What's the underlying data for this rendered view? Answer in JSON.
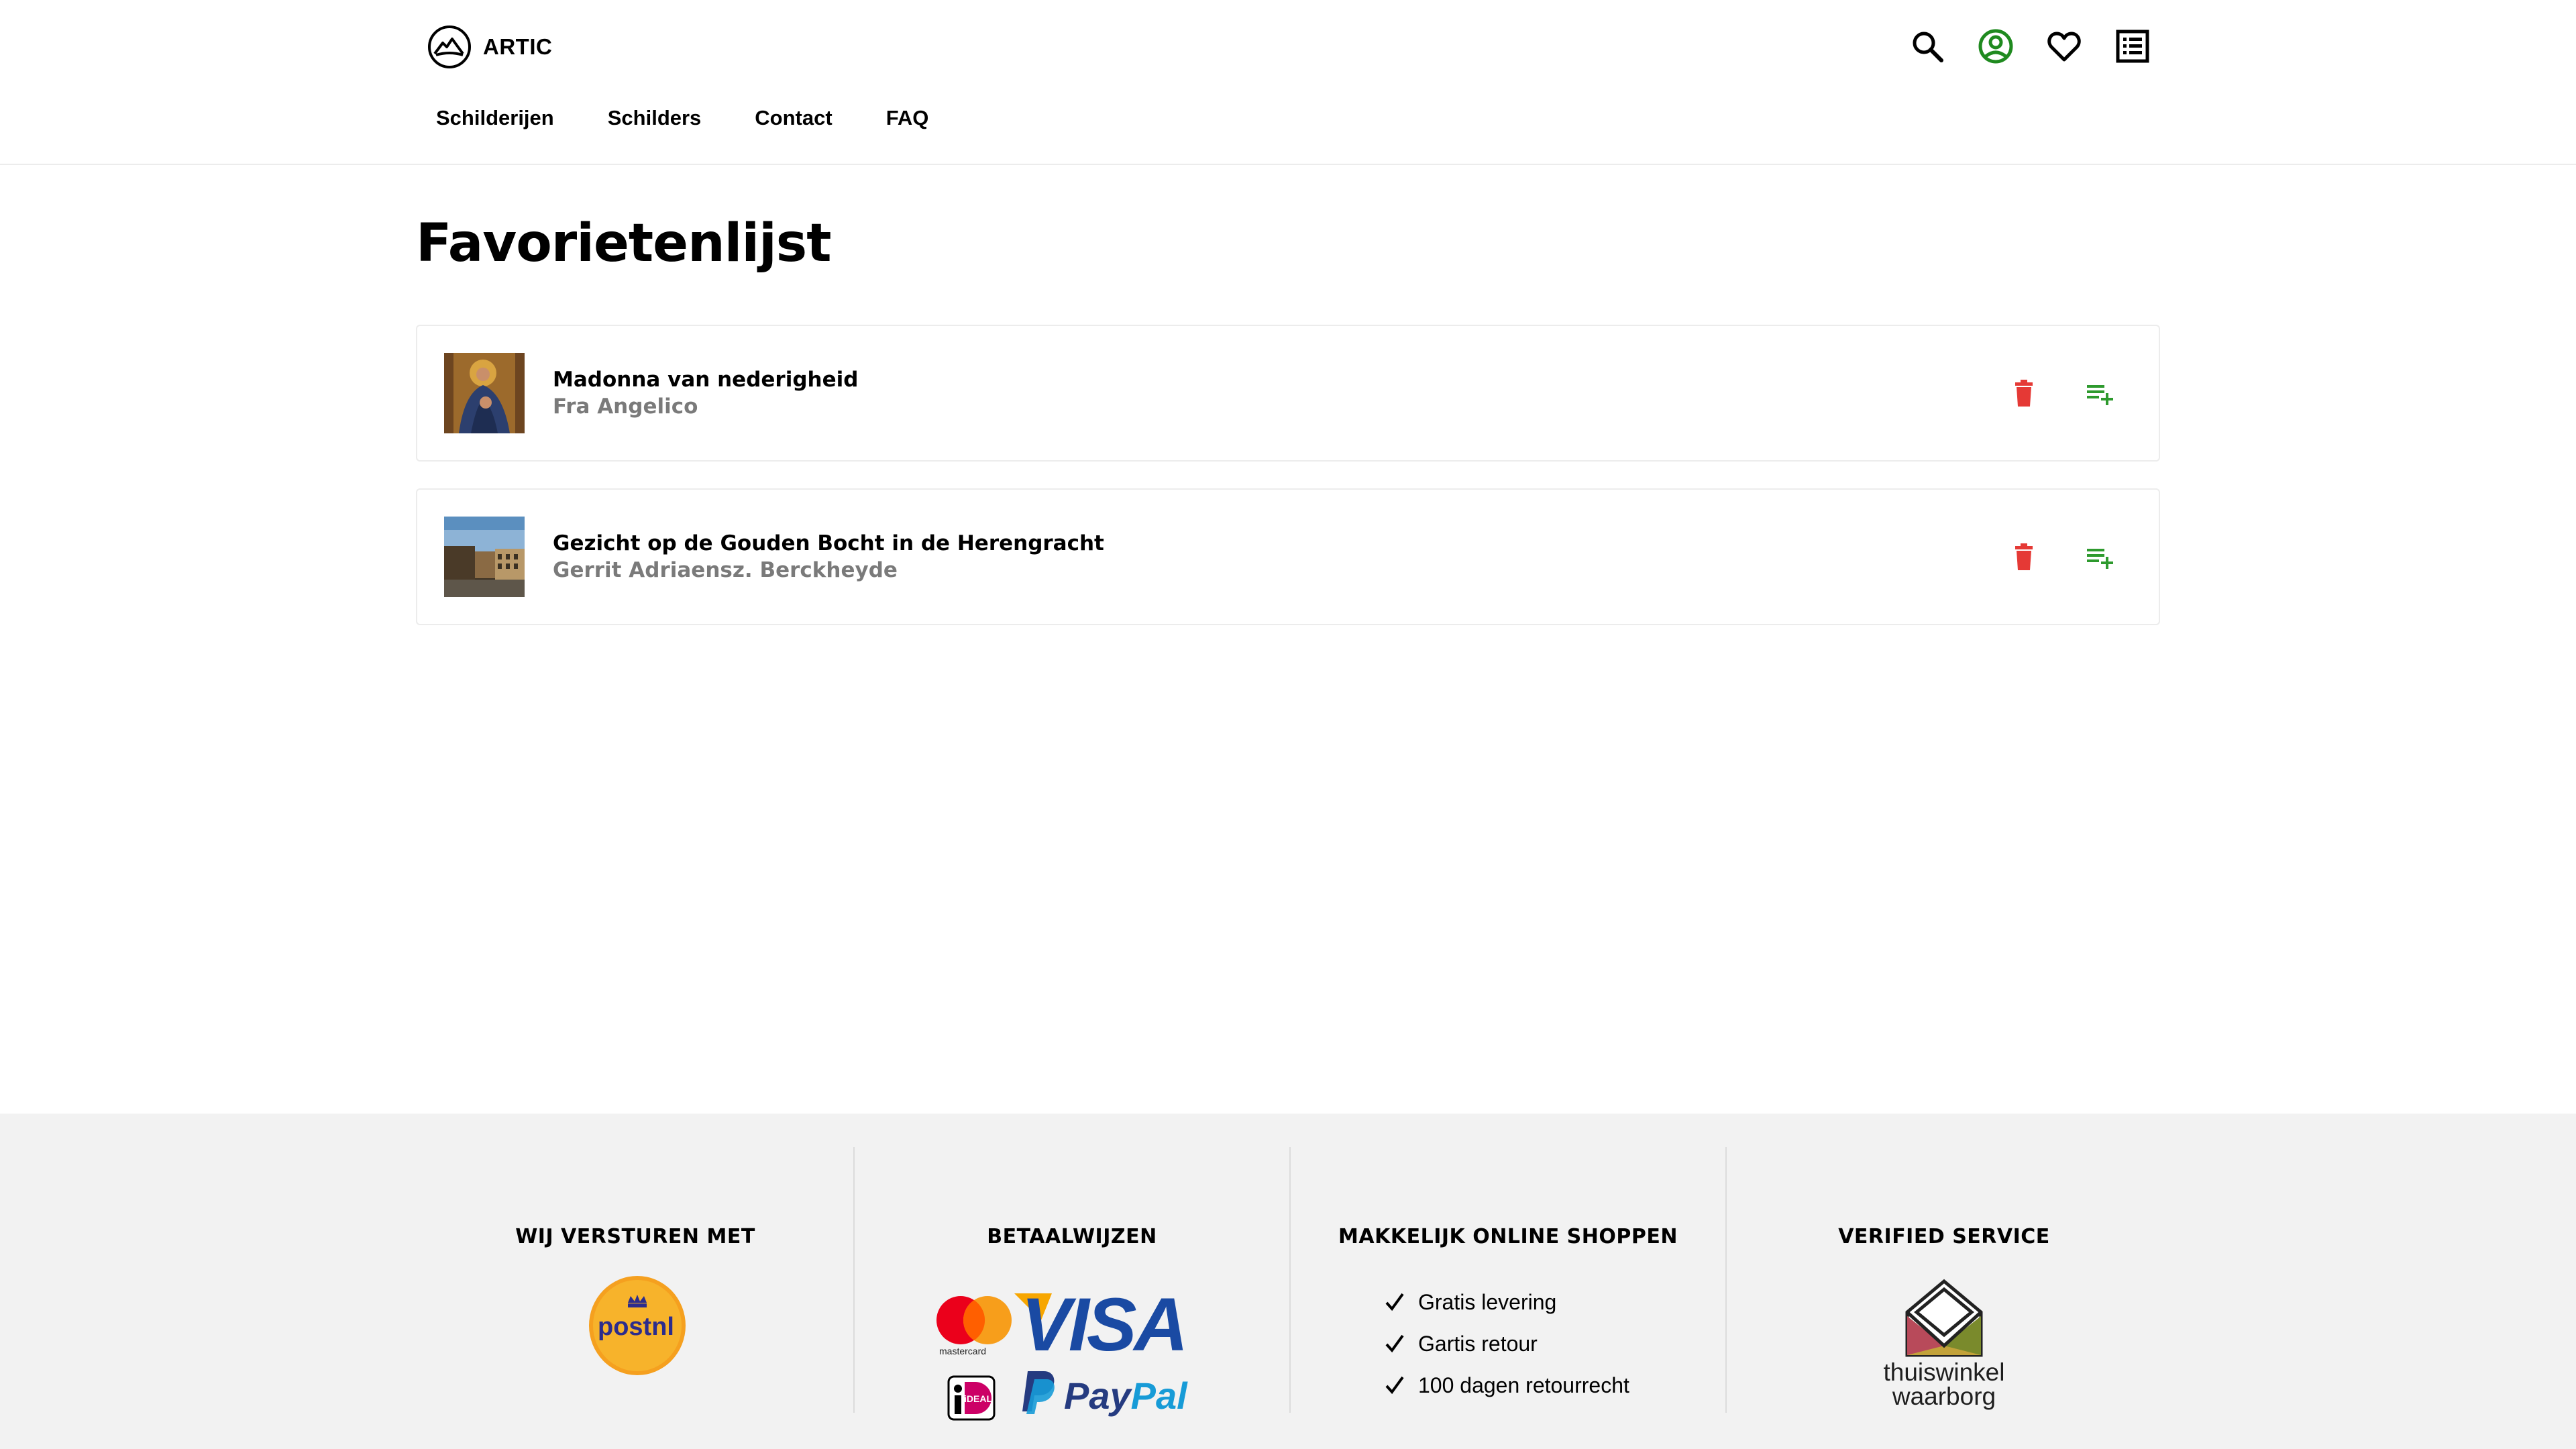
{
  "brand": {
    "name": "ARTIC"
  },
  "nav": {
    "items": [
      {
        "label": "Schilderijen"
      },
      {
        "label": "Schilders"
      },
      {
        "label": "Contact"
      },
      {
        "label": "FAQ"
      }
    ]
  },
  "header_icons": [
    "search-icon",
    "account-icon",
    "heart-icon",
    "list-icon"
  ],
  "page": {
    "title": "Favorietenlijst"
  },
  "favorites": [
    {
      "title": "Madonna van nederigheid",
      "artist": "Fra Angelico"
    },
    {
      "title": "Gezicht op de Gouden Bocht in de Herengracht",
      "artist": "Gerrit Adriaensz. Berckheyde"
    }
  ],
  "footer": {
    "shipping": {
      "heading": "WIJ VERSTUREN MET",
      "logo_text": "postnl"
    },
    "payment": {
      "heading": "BETAALWIJZEN",
      "mastercard_label": "mastercard",
      "visa_label": "VISA",
      "ideal_label": "iDEAL",
      "paypal_pay": "Pay",
      "paypal_pal": "Pal"
    },
    "shopping": {
      "heading": "MAKKELIJK ONLINE SHOPPEN",
      "items": [
        "Gratis levering",
        "Gartis retour",
        "100 dagen retourrecht"
      ]
    },
    "verified": {
      "heading": "VERIFIED SERVICE",
      "logo_line1": "thuiswinkel",
      "logo_line2": "waarborg"
    }
  },
  "colors": {
    "account_icon": "#1f8a1f",
    "delete_icon": "#e53935",
    "add_to_list_icon": "#2e9a2e",
    "footer_bg": "#f2f2f2"
  }
}
